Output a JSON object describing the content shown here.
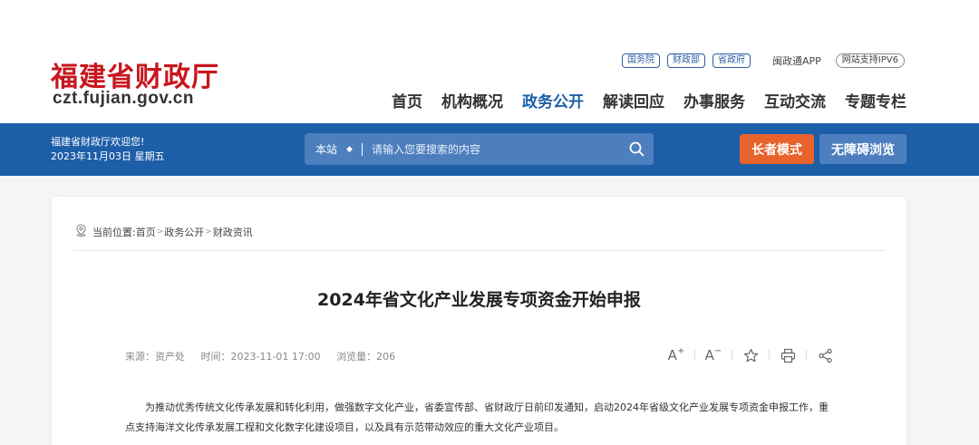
{
  "site": {
    "name": "福建省财政厅",
    "url": "czt.fujian.gov.cn"
  },
  "top_links": [
    "国务院",
    "财政部",
    "省政府"
  ],
  "app_link": "闽政通APP",
  "ipv6": "网站支持IPV6",
  "nav": [
    "首页",
    "机构概况",
    "政务公开",
    "解读回应",
    "办事服务",
    "互动交流",
    "专题专栏"
  ],
  "nav_active_index": 2,
  "welcome": {
    "line1": "福建省财政厅欢迎您!",
    "line2": "2023年11月03日 星期五"
  },
  "search": {
    "scope": "本站",
    "scope_arrow": "◆",
    "placeholder": "请输入您要搜索的内容",
    "icon": "search-icon"
  },
  "buttons": {
    "elder": "长者模式",
    "accessible": "无障碍浏览"
  },
  "breadcrumb": {
    "label": "当前位置:",
    "items": [
      "首页",
      "政务公开",
      "财政资讯"
    ],
    "separator": ">"
  },
  "article": {
    "title": "2024年省文化产业发展专项资金开始申报",
    "source": "来源：资产处",
    "time": "时间：2023-11-01 17:00",
    "views": "浏览量：206",
    "body": "为推动优秀传统文化传承发展和转化利用，做强数字文化产业，省委宣传部、省财政厅日前印发通知，启动2024年省级文化产业发展专项资金申报工作，重点支持海洋文化传承发展工程和文化数字化建设项目，以及具有示范带动效应的重大文化产业项目。"
  },
  "tools": {
    "font_increase": "A",
    "font_decrease": "A",
    "font_increase_mark": "+",
    "font_decrease_mark": "−"
  },
  "colors": {
    "brand_red": "#c8161d",
    "brand_blue": "#1d5ea8",
    "elder_orange": "#e8622c"
  }
}
